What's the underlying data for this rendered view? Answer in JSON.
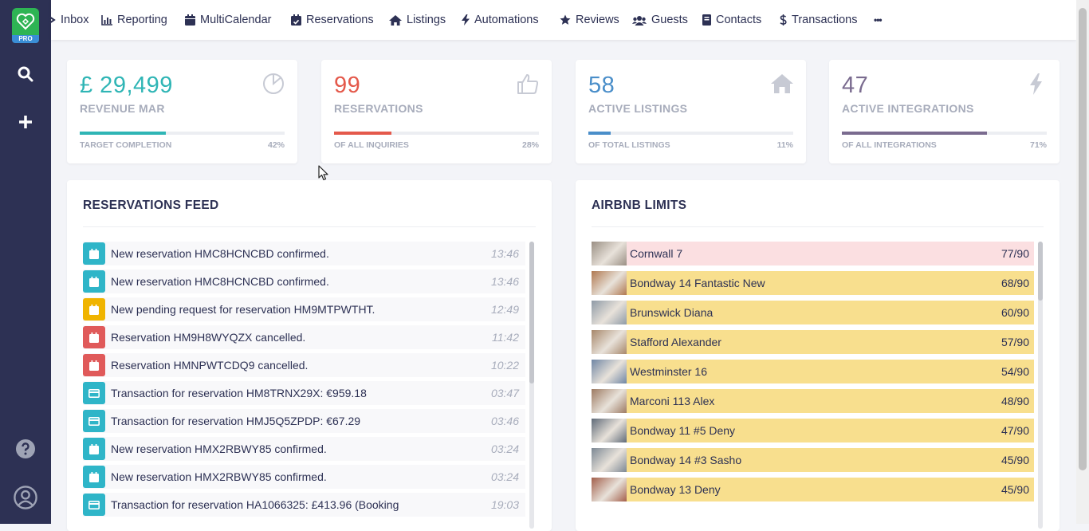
{
  "app": {
    "logo_badge": "PRO"
  },
  "nav": {
    "items": [
      {
        "label": "Inbox",
        "icon": "inbox-icon"
      },
      {
        "label": "Reporting",
        "icon": "chart-icon"
      },
      {
        "label": "MultiCalendar",
        "icon": "calendar-icon"
      },
      {
        "label": "Reservations",
        "icon": "calendar-check-icon"
      },
      {
        "label": "Listings",
        "icon": "home-icon"
      },
      {
        "label": "Automations",
        "icon": "bolt-icon"
      },
      {
        "label": "Reviews",
        "icon": "star-icon"
      },
      {
        "label": "Guests",
        "icon": "users-icon"
      },
      {
        "label": "Contacts",
        "icon": "address-book-icon"
      },
      {
        "label": "Transactions",
        "icon": "dollar-icon"
      }
    ],
    "more_label": "•••"
  },
  "stats": [
    {
      "value": "£ 29,499",
      "label": "REVENUE MAR",
      "foot": "TARGET COMPLETION",
      "percent": "42%",
      "fraction": 0.42,
      "color": "#2fb5b5",
      "icon": "pie-chart-icon"
    },
    {
      "value": "99",
      "label": "RESERVATIONS",
      "foot": "OF ALL INQUIRIES",
      "percent": "28%",
      "fraction": 0.28,
      "color": "#e4594b",
      "icon": "thumbs-up-icon"
    },
    {
      "value": "58",
      "label": "ACTIVE LISTINGS",
      "foot": "OF TOTAL LISTINGS",
      "percent": "11%",
      "fraction": 0.11,
      "color": "#4a8ec9",
      "icon": "home-icon"
    },
    {
      "value": "47",
      "label": "ACTIVE INTEGRATIONS",
      "foot": "OF ALL INTEGRATIONS",
      "percent": "71%",
      "fraction": 0.71,
      "color": "#7a6b8f",
      "icon": "bolt-icon"
    }
  ],
  "feed": {
    "title": "RESERVATIONS FEED",
    "items": [
      {
        "type": "confirmed",
        "text": "New reservation HMC8HCNCBD confirmed.",
        "time": "13:46"
      },
      {
        "type": "confirmed",
        "text": "New reservation HMC8HCNCBD confirmed.",
        "time": "13:46"
      },
      {
        "type": "pending",
        "text": "New pending request for reservation HM9MTPWTHT.",
        "time": "12:49"
      },
      {
        "type": "cancelled",
        "text": "Reservation HM9H8WYQZX cancelled.",
        "time": "11:42"
      },
      {
        "type": "cancelled",
        "text": "Reservation HMNPWTCDQ9 cancelled.",
        "time": "10:22"
      },
      {
        "type": "transaction",
        "text": "Transaction for reservation HM8TRNX29X: €959.18",
        "time": "03:47"
      },
      {
        "type": "transaction",
        "text": "Transaction for reservation HMJ5Q5ZPDP: €67.29",
        "time": "03:46"
      },
      {
        "type": "confirmed",
        "text": "New reservation HMX2RBWY85 confirmed.",
        "time": "03:24"
      },
      {
        "type": "confirmed",
        "text": "New reservation HMX2RBWY85 confirmed.",
        "time": "03:24"
      },
      {
        "type": "transaction",
        "text": "Transaction for reservation HA1066325: £413.96 (Booking",
        "time": "19:03"
      }
    ],
    "type_colors": {
      "confirmed": "#2fb5c8",
      "pending": "#f0b400",
      "cancelled": "#e05a5a",
      "transaction": "#2fb5c8"
    }
  },
  "limits": {
    "title": "AIRBNB LIMITS",
    "items": [
      {
        "name": "Cornwall 7",
        "count": "77/90",
        "status": "over",
        "thumb": "#9a8f84"
      },
      {
        "name": "Bondway 14 Fantastic New",
        "count": "68/90",
        "status": "warn",
        "thumb": "#b07850"
      },
      {
        "name": "Brunswick Diana",
        "count": "60/90",
        "status": "warn",
        "thumb": "#8e9aa6"
      },
      {
        "name": "Stafford Alexander",
        "count": "57/90",
        "status": "warn",
        "thumb": "#a7876a"
      },
      {
        "name": "Westminster 16",
        "count": "54/90",
        "status": "warn",
        "thumb": "#6f86a4"
      },
      {
        "name": "Marconi 113 Alex",
        "count": "48/90",
        "status": "warn",
        "thumb": "#9d7a62"
      },
      {
        "name": "Bondway 11 #5 Deny",
        "count": "47/90",
        "status": "warn",
        "thumb": "#5f6a78"
      },
      {
        "name": "Bondway 14 #3 Sasho",
        "count": "45/90",
        "status": "warn",
        "thumb": "#7c8894"
      },
      {
        "name": "Bondway 13 Deny",
        "count": "45/90",
        "status": "warn",
        "thumb": "#a35f4b"
      }
    ],
    "status_colors": {
      "over": "#fbdfe1",
      "warn": "#f8df8e"
    }
  }
}
